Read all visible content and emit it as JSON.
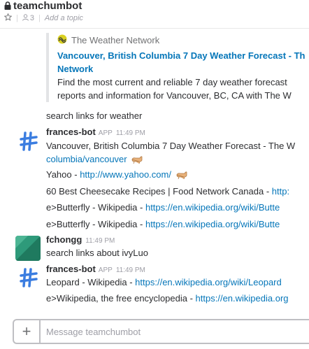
{
  "channel": {
    "name": "teamchumbot",
    "member_count": "3",
    "add_topic": "Add a topic"
  },
  "attachment": {
    "service": "The Weather Network",
    "title": "Vancouver, British Columbia 7 Day Weather Forecast - Th\nNetwork",
    "text": "Find the most current and reliable 7 day weather forecast\nreports and information for Vancouver, BC, CA with The W"
  },
  "user_message_1": "search links for weather",
  "bot_message_1": {
    "sender": "frances-bot",
    "tag": "APP",
    "time": "11:49 PM",
    "line1_text": "Vancouver, British Columbia 7 Day Weather Forecast - The W",
    "line2_link": "columbia/vancouver",
    "line3_text": "Yahoo - ",
    "line3_link": "http://www.yahoo.com/",
    "line4_text": "60 Best Cheesecake Recipes | Food Network Canada - ",
    "line4_link": "http:",
    "line5_text": "e>Butterfly - Wikipedia - ",
    "line5_link": "https://en.wikipedia.org/wiki/Butte",
    "line6_text": "e>Butterfly - Wikipedia - ",
    "line6_link": "https://en.wikipedia.org/wiki/Butte"
  },
  "user_message_2": {
    "sender": "fchongg",
    "time": "11:49 PM",
    "text": "search links about ivyLuo"
  },
  "bot_message_2": {
    "sender": "frances-bot",
    "tag": "APP",
    "time": "11:49 PM",
    "line1_text": "Leopard - Wikipedia - ",
    "line1_link": "https://en.wikipedia.org/wiki/Leopard",
    "line2_text": "e>Wikipedia, the free encyclopedia - ",
    "line2_link": "https://en.wikipedia.org"
  },
  "composer": {
    "placeholder": "Message teamchumbot"
  },
  "colors": {
    "link": "#0576b9",
    "bot_avatar": "#3b7de0",
    "user_avatar": "#2e9a7a"
  },
  "icons": [
    "lock-icon",
    "star-icon",
    "person-icon",
    "weather-network-icon",
    "cat-emoji",
    "plus-icon"
  ]
}
